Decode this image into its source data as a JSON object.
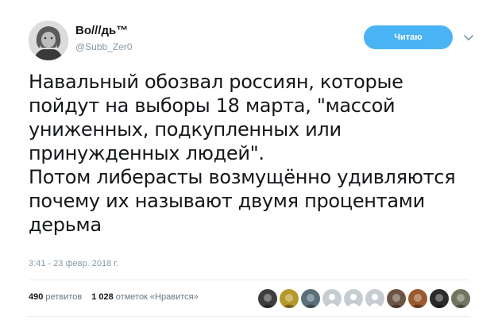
{
  "author": {
    "name": "Во///дь™",
    "handle": "@Subb_Zer0",
    "avatar_icon": "bearded-man-avatar"
  },
  "follow_button": {
    "label": "Читаю",
    "color": "#4ab3f4"
  },
  "menu_icon": "chevron-down-icon",
  "tweet": {
    "text": "Навальный обозвал россиян, которые\nпойдут на выборы 18 марта, \"массой\nуниженных, подкупленных или\nпринужденных людей\".\nПотом либерасты возмущённо удивляются\nпочему их называют двумя процентами\nдерьма",
    "timestamp": "3:41 - 23 февр. 2018 г."
  },
  "stats": {
    "retweets_count": "490",
    "retweets_label": "ретвитов",
    "likes_count": "1 028",
    "likes_label": "отметок «Нравится»"
  },
  "likers": [
    {
      "icon": "avatar-dark-photo",
      "color": "#3d3d3d"
    },
    {
      "icon": "avatar-yellow-photo",
      "color": "#b59a2a"
    },
    {
      "icon": "avatar-ball-photo",
      "color": "#5a6f7a"
    },
    {
      "icon": "avatar-default-egg",
      "color": "#c5cdd2"
    },
    {
      "icon": "avatar-default-egg",
      "color": "#c5cdd2"
    },
    {
      "icon": "avatar-default-egg",
      "color": "#c5cdd2"
    },
    {
      "icon": "avatar-brown-photo",
      "color": "#6b5444"
    },
    {
      "icon": "avatar-sunset-photo",
      "color": "#9a5a2e"
    },
    {
      "icon": "avatar-mono-photo",
      "color": "#2b2b2b"
    },
    {
      "icon": "avatar-outdoor-photo",
      "color": "#6f7560"
    }
  ]
}
